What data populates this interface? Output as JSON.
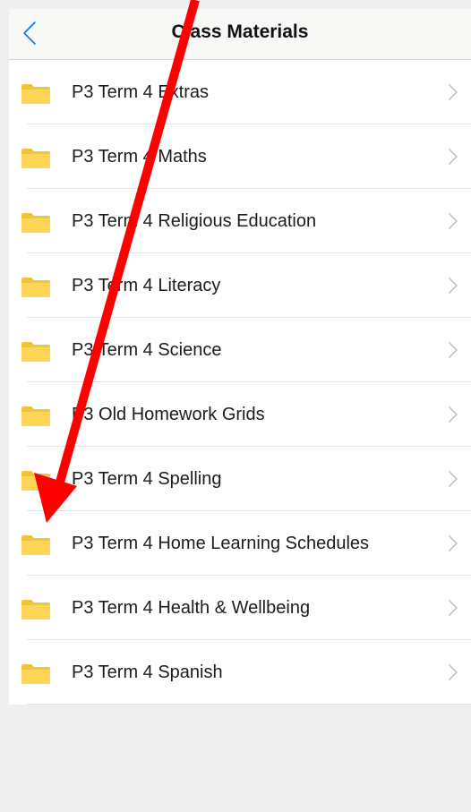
{
  "header": {
    "title": "Class Materials",
    "back_icon": "chevron-left-icon"
  },
  "folders": [
    {
      "label": "P3 Term 4 Extras"
    },
    {
      "label": "P3 Term 4 Maths"
    },
    {
      "label": "P3 Term 4 Religious Education"
    },
    {
      "label": "P3 Term 4 Literacy"
    },
    {
      "label": "P3 Term 4 Science"
    },
    {
      "label": "P3 Old Homework Grids"
    },
    {
      "label": "P3 Term 4 Spelling"
    },
    {
      "label": "P3 Term 4 Home Learning Schedules"
    },
    {
      "label": "P3 Term 4 Health & Wellbeing"
    },
    {
      "label": "P3 Term 4 Spanish"
    }
  ],
  "icons": {
    "folder": "folder-icon",
    "row_chevron": "chevron-right-icon"
  },
  "colors": {
    "accent": "#007aff",
    "folder": "#fcd556",
    "annotation_arrow": "#ff0000"
  }
}
